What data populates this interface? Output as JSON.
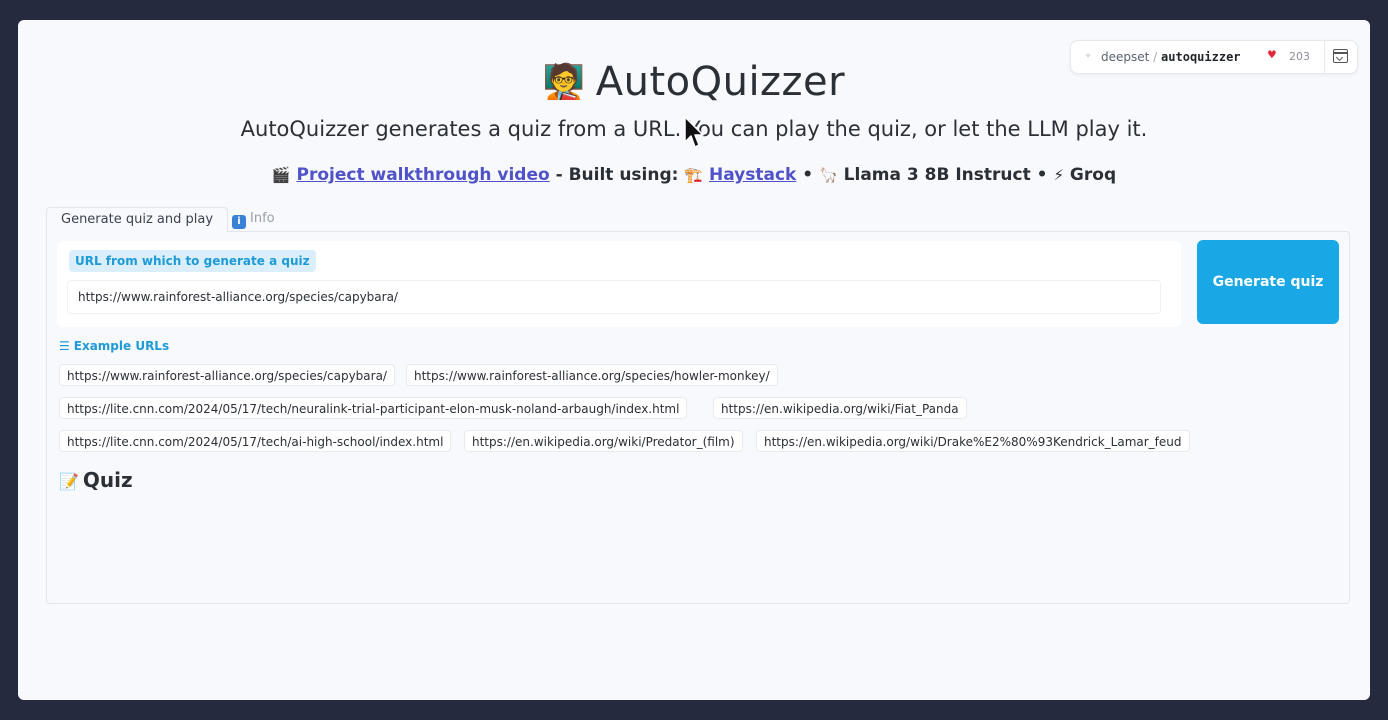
{
  "app": {
    "title_emoji": "🧑‍🏫",
    "title": "AutoQuizzer",
    "subtitle": "AutoQuizzer generates a quiz from a URL. You can play the quiz, or let the LLM play it."
  },
  "credits": {
    "video_icon": "🎬",
    "video_link": "Project walkthrough video",
    "built_using": "- Built using:",
    "haystack_icon": "🏗️",
    "haystack_link": "Haystack",
    "bullet1": "•",
    "llama_icon": "🦙",
    "llama": "Llama 3 8B Instruct",
    "bullet2": "•",
    "groq_icon": "⚡",
    "groq": "Groq"
  },
  "hf_badge": {
    "owner": "deepset",
    "separator": "/",
    "repo": "autoquizzer",
    "likes": "203",
    "heart_icon": "heart-icon",
    "menu_icon": "menu-icon"
  },
  "tabs": [
    {
      "label": "Generate quiz and play",
      "active": true
    },
    {
      "label": "Info",
      "icon": "i",
      "active": false
    }
  ],
  "form": {
    "url_label": "URL from which to generate a quiz",
    "url_value": "https://www.rainforest-alliance.org/species/capybara/",
    "generate_button": "Generate quiz"
  },
  "examples": {
    "heading_icon": "☰",
    "heading": "Example URLs",
    "rows": [
      [
        "https://www.rainforest-alliance.org/species/capybara/",
        "https://www.rainforest-alliance.org/species/howler-monkey/"
      ],
      [
        "https://lite.cnn.com/2024/05/17/tech/neuralink-trial-participant-elon-musk-noland-arbaugh/index.html",
        "https://en.wikipedia.org/wiki/Fiat_Panda"
      ],
      [
        "https://lite.cnn.com/2024/05/17/tech/ai-high-school/index.html",
        "https://en.wikipedia.org/wiki/Predator_(film)",
        "https://en.wikipedia.org/wiki/Drake%E2%80%93Kendrick_Lamar_feud"
      ]
    ]
  },
  "quiz": {
    "icon": "📝",
    "heading": "Quiz"
  },
  "colors": {
    "accent": "#1aa7e6",
    "link": "#4f52c9",
    "label_bg": "#dbeefb",
    "outer_bg": "#262a3e"
  }
}
